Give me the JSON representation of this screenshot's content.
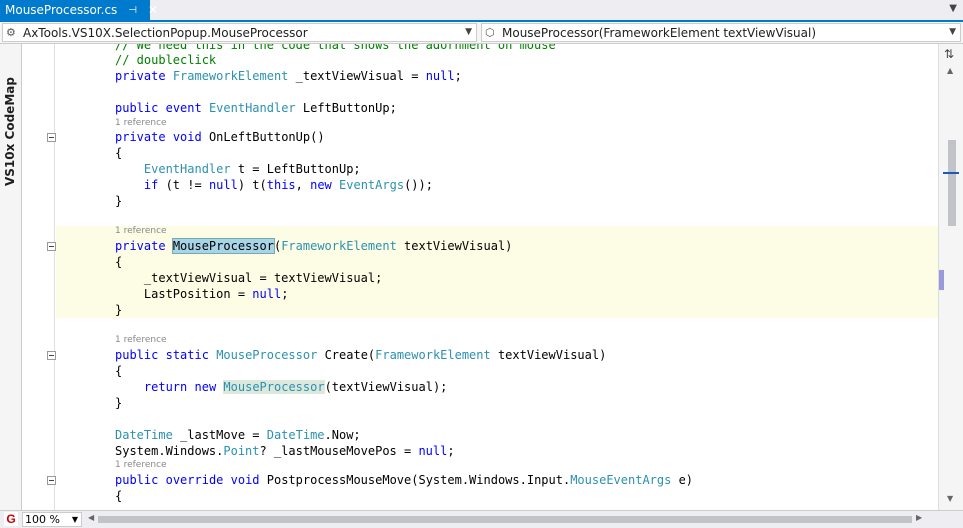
{
  "tab": {
    "title": "MouseProcessor.cs",
    "pin": "⊣",
    "close": "✕"
  },
  "nav": {
    "left_combo": "AxTools.VS10X.SelectionPopup.MouseProcessor",
    "right_combo": "MouseProcessor(FrameworkElement textViewVisual)"
  },
  "sidebar": {
    "label": "VS10x CodeMap"
  },
  "code": {
    "l0": "// We need this in the code that shows the adornment on mouse",
    "l1": "// doubleclick",
    "ref": "1 reference"
  },
  "status": {
    "g_label": "G",
    "zoom": "100 %"
  },
  "icons": {
    "tab_pin": "pin-icon",
    "tab_close": "close-icon",
    "left_combo": "class-icon",
    "right_combo": "method-icon",
    "splitter": "split-icon",
    "g": "g-icon"
  }
}
